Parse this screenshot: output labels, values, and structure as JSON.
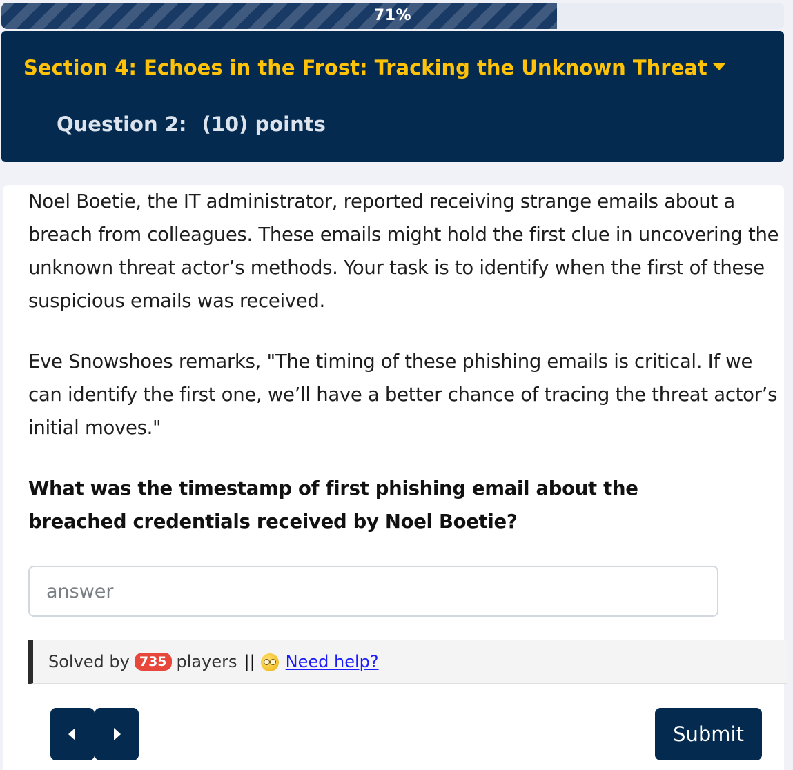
{
  "progress": {
    "label": "71%",
    "fraction": 0.71,
    "fill_color": "#1a3a66"
  },
  "header": {
    "section_title": "Section 4: Echoes in the Frost: Tracking the Unknown Threat",
    "question_label": "Question 2:",
    "points_label": "(10) points",
    "background": "#042a4f",
    "accent": "#ffc20a"
  },
  "body": {
    "paragraph1": "Noel Boetie, the IT administrator, reported receiving strange emails about a breach from colleagues. These emails might hold the first clue in uncovering the unknown threat actor’s methods. Your task is to identify when the first of these suspicious emails was received.",
    "paragraph2": "Eve Snowshoes remarks, \"The timing of these phishing emails is critical. If we can identify the first one, we’ll have a better chance of tracing the threat actor’s initial moves.\"",
    "question": "What was the timestamp of first phishing email about the breached credentials received by Noel Boetie?"
  },
  "answer": {
    "placeholder": "answer",
    "value": ""
  },
  "help": {
    "solved_prefix": "Solved by",
    "solved_count": "735",
    "solved_suffix": "players",
    "separator": "||",
    "emoji_icon": "woozy-face-icon",
    "link_label": "Need help?",
    "badge_color": "#e7483b"
  },
  "navigation": {
    "prev_icon": "triangle-left-icon",
    "next_icon": "triangle-right-icon",
    "submit_label": "Submit"
  }
}
